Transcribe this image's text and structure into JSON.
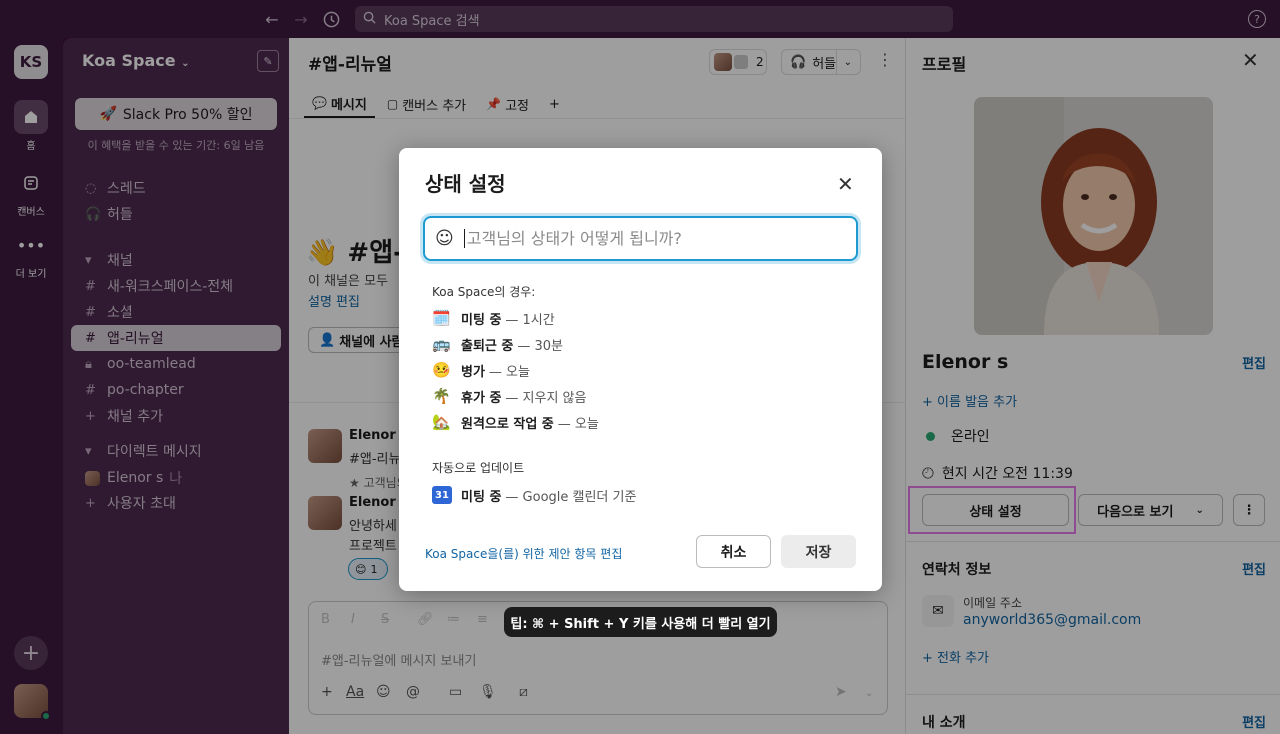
{
  "topbar": {
    "search_placeholder": "Koa Space 검색",
    "icons": [
      "back-arrow-icon",
      "forward-arrow-icon",
      "history-icon",
      "search-icon",
      "help-icon"
    ]
  },
  "rail": {
    "workspace_initials": "KS",
    "items": [
      {
        "label": "홈",
        "icon": "home-icon"
      },
      {
        "label": "캔버스",
        "icon": "canvas-icon"
      },
      {
        "label": "더 보기",
        "icon": "more-icon"
      }
    ]
  },
  "sidebar": {
    "workspace_name": "Koa Space",
    "promo_label": "Slack Pro 50% 할인",
    "promo_sub": "이 혜택을 받을 수 있는 기간: 6일 남음",
    "threads": "스레드",
    "huddles": "허들",
    "channels_header": "채널",
    "channels": [
      "새-워크스페이스-전체",
      "소셜",
      "앱-리뉴얼",
      "oo-teamlead",
      "po-chapter"
    ],
    "add_channel": "채널 추가",
    "dm_header": "다이렉트 메시지",
    "dm_user": "Elenor s",
    "dm_user_suffix": "나",
    "invite": "사용자 초대"
  },
  "channel": {
    "title": "#앱-리뉴얼",
    "member_count": "2",
    "huddle_label": "허들",
    "tabs": [
      "메시지",
      "캔버스 추가",
      "고정"
    ],
    "intro_title": "👋 #앱-",
    "intro_text": "이 채널은 모두",
    "intro_link": "설명 편집",
    "add_people": "채널에 사람",
    "messages": [
      {
        "name": "Elenor s",
        "line1": "#앱-리뉴얼"
      },
      {
        "name": "Elenor s",
        "pinned": "고객님의",
        "line1": "안녕하세",
        "line2": "프로젝트"
      }
    ],
    "reaction_count": "1",
    "composer_placeholder": "#앱-리뉴얼에 메시지 보내기",
    "composer_tool": "Aa"
  },
  "profile": {
    "title": "프로필",
    "name": "Elenor s",
    "edit": "편집",
    "add_pronunciation": "+ 이름 발음 추가",
    "presence": "온라인",
    "local_time": "현지 시간 오전 11:39",
    "set_status_button": "상태 설정",
    "view_as_button": "다음으로 보기",
    "contact_header": "연락처 정보",
    "email_label": "이메일 주소",
    "email": "anyworld365@gmail.com",
    "add_phone": "+ 전화 추가",
    "about_header": "내 소개"
  },
  "modal": {
    "title": "상태 설정",
    "input_placeholder": "고객님의 상태가 어떻게 됩니까?",
    "suggestions_header": "Koa Space의 경우:",
    "suggestions": [
      {
        "emoji": "🗓️",
        "label": "미팅 중",
        "duration": "— 1시간"
      },
      {
        "emoji": "🚌",
        "label": "출퇴근 중",
        "duration": "— 30분"
      },
      {
        "emoji": "🤒",
        "label": "병가",
        "duration": "— 오늘"
      },
      {
        "emoji": "🌴",
        "label": "휴가 중",
        "duration": "— 지우지 않음"
      },
      {
        "emoji": "🏡",
        "label": "원격으로 작업 중",
        "duration": "— 오늘"
      }
    ],
    "auto_header": "자동으로 업데이트",
    "auto_item": {
      "calendar_day": "31",
      "label": "미팅 중",
      "duration": "— Google 캘린더 기준"
    },
    "edit_suggestions": "Koa Space을(를) 위한 제안 항목 편집",
    "cancel": "취소",
    "save": "저장"
  },
  "tooltip": "팁: ⌘ + Shift + Y 키를 사용해 더 빨리 열기",
  "colors": {
    "accent": "#1d9bd1",
    "link": "#1264a3",
    "aubergine": "#3d1a3f",
    "highlight": "#e87be8"
  }
}
